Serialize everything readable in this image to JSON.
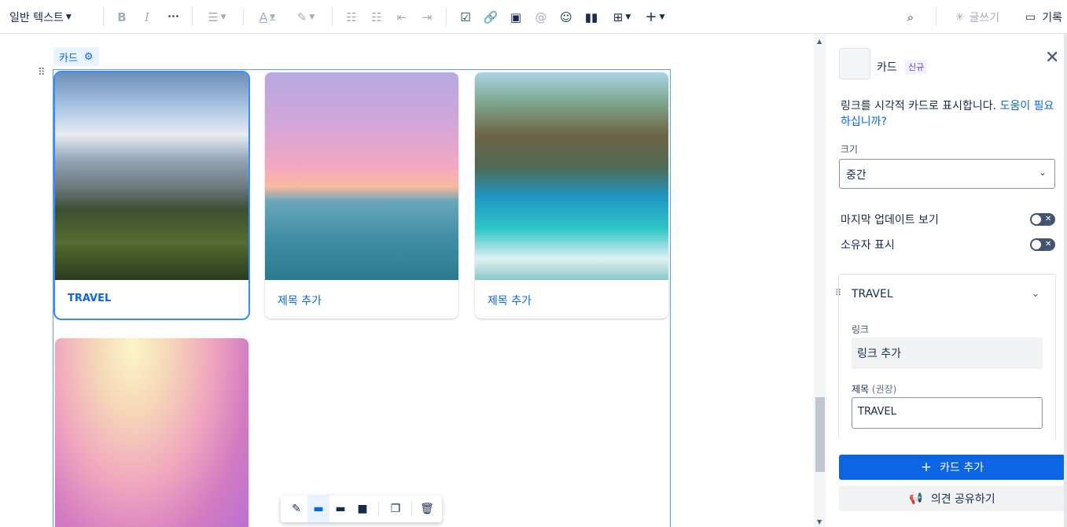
{
  "toolbar": {
    "text_style": "일반 텍스트",
    "bold": "B",
    "italic": "I",
    "more": "•••",
    "write_ai": "글쓰기",
    "record": "기록"
  },
  "editor": {
    "chip_label": "카드",
    "cards": [
      {
        "title": "TRAVEL",
        "selected": true
      },
      {
        "title": "제목 추가",
        "selected": false
      },
      {
        "title": "제목 추가",
        "selected": false
      },
      {
        "title": "",
        "selected": false
      }
    ]
  },
  "panel": {
    "title": "카드",
    "badge": "신규",
    "description": "링크를 시각적 카드로 표시합니다.",
    "help_link": "도움이 필요하십니까?",
    "size_label": "크기",
    "size_value": "중간",
    "toggles": [
      {
        "label": "마지막 업데이트 보기",
        "on": false
      },
      {
        "label": "소유자 표시",
        "on": false
      }
    ],
    "card_section": {
      "title": "TRAVEL",
      "link_label": "링크",
      "link_placeholder": "링크 추가",
      "title_label": "제목",
      "title_hint": "(권장)",
      "title_value": "TRAVEL"
    },
    "add_card_button": "카드 추가",
    "feedback_button": "의견 공유하기"
  },
  "colors": {
    "accent": "#0c66e4",
    "selection": "#388bff"
  }
}
